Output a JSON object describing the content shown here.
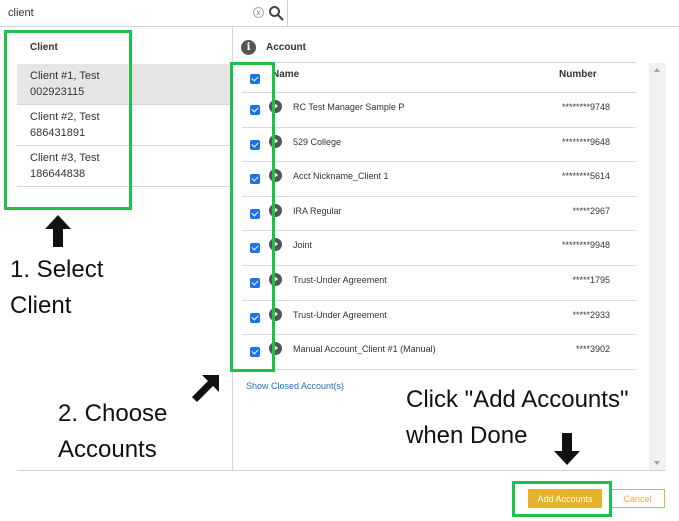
{
  "search": {
    "value": "client",
    "clear_glyph": "x",
    "icon": "search-icon"
  },
  "client_panel": {
    "header": "Client",
    "items": [
      {
        "name": "Client #1, Test",
        "id": "002923115",
        "selected": true
      },
      {
        "name": "Client #2, Test",
        "id": "686431891",
        "selected": false
      },
      {
        "name": "Client #3, Test",
        "id": "186644838",
        "selected": false
      }
    ]
  },
  "account_panel": {
    "info_glyph": "i",
    "header": "Account",
    "col_name": "Name",
    "col_number": "Number",
    "rows": [
      {
        "name": "RC Test Manager Sample P",
        "number": "********9748",
        "checked": true
      },
      {
        "name": "529 College",
        "number": "********9648",
        "checked": true
      },
      {
        "name": "Acct Nickname_Client 1",
        "number": "********5614",
        "checked": true
      },
      {
        "name": "IRA Regular",
        "number": "*****2967",
        "checked": true
      },
      {
        "name": "Joint",
        "number": "********9948",
        "checked": true
      },
      {
        "name": "Trust-Under Agreement",
        "number": "*****1795",
        "checked": true
      },
      {
        "name": "Trust-Under Agreement",
        "number": "*****2933",
        "checked": true
      },
      {
        "name": "Manual Account_Client #1 (Manual)",
        "number": "****3902",
        "checked": true
      }
    ],
    "show_closed": "Show Closed Account(s)"
  },
  "annotations": {
    "step1_line1": "1. Select",
    "step1_line2": "Client",
    "step2_line1": "2. Choose",
    "step2_line2": "Accounts",
    "step3_line1": "Click \"Add Accounts\"",
    "step3_line2": "when Done",
    "highlight_color": "#1ec24a"
  },
  "buttons": {
    "add": "Add Accounts",
    "cancel": "Cancel"
  },
  "colors": {
    "accent": "#e6b229",
    "checkbox": "#1a73e8",
    "link": "#2a6db5"
  }
}
